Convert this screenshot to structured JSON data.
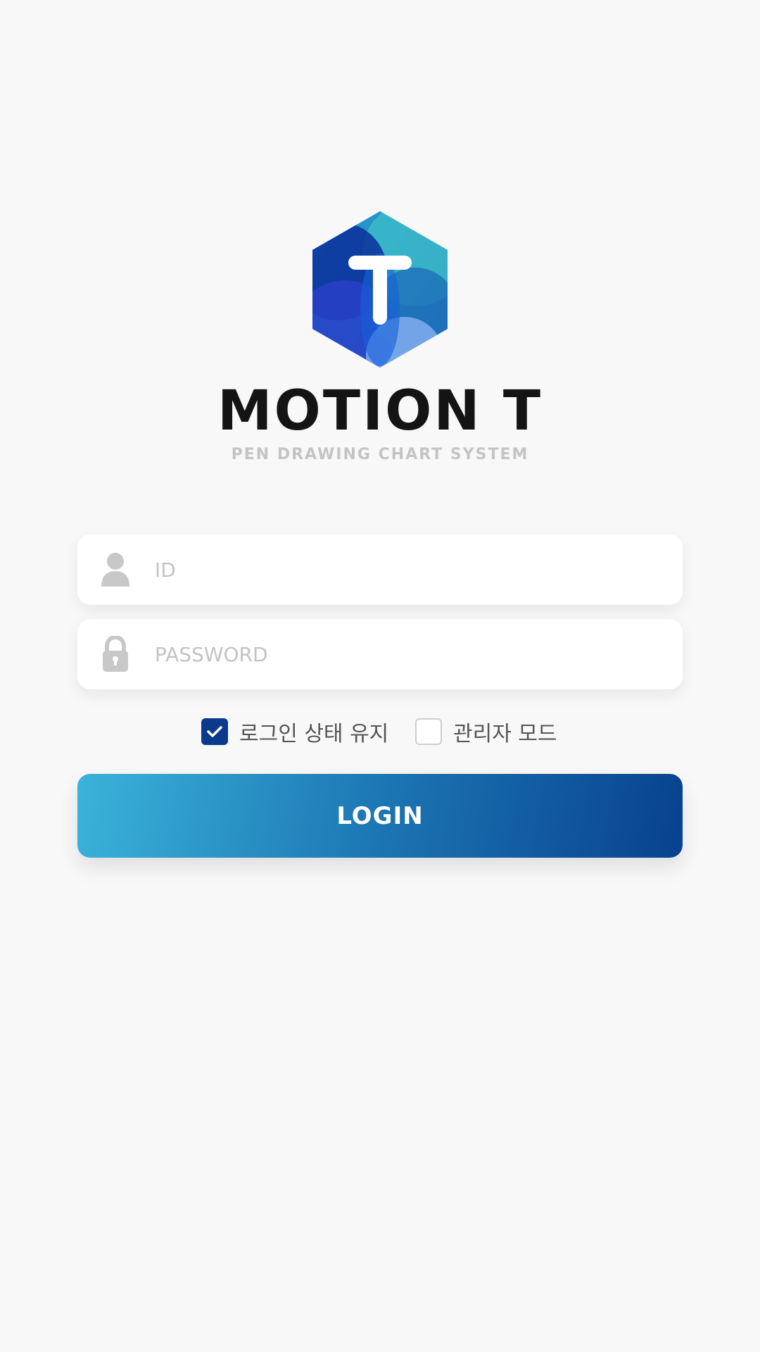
{
  "brand": {
    "title": "MOTION T",
    "subtitle": "PEN DRAWING CHART SYSTEM",
    "logo_letter": "T"
  },
  "form": {
    "id_placeholder": "ID",
    "id_value": "",
    "password_placeholder": "PASSWORD",
    "password_value": "",
    "keep_login_label": "로그인 상태 유지",
    "keep_login_checked": true,
    "admin_mode_label": "관리자 모드",
    "admin_mode_checked": false,
    "login_label": "LOGIN"
  },
  "icons": {
    "id_icon": "user-icon",
    "password_icon": "lock-icon",
    "check_icon": "checkmark-icon"
  },
  "colors": {
    "background": "#f8f8f9",
    "checkbox_checked": "#0b3a8c",
    "button_gradient_start": "#3ab3da",
    "button_gradient_end": "#08418f",
    "placeholder": "#c3c3c3"
  }
}
